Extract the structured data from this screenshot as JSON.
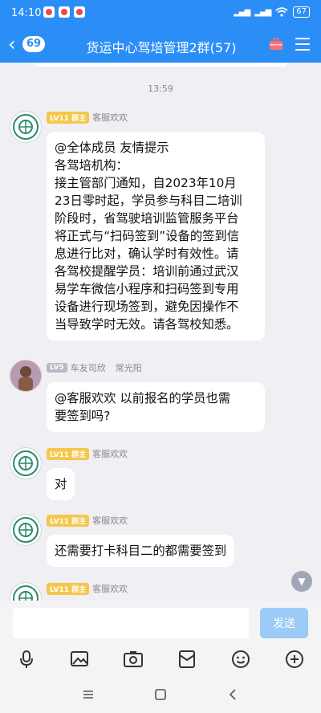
{
  "status_bar": {
    "time": "14:10",
    "battery": "67"
  },
  "header": {
    "unread_count": "69",
    "title": "货运中心驾培管理2群(57)"
  },
  "chat": {
    "timestamp": "13:59",
    "messages": [
      {
        "level": "LV11",
        "role": "群主",
        "sender": "客服欢欢",
        "lines": [
          "@全体成员 友情提示",
          "各驾培机构：",
          "接主管部门通知，自2023年10月",
          "23日零时起，学员参与科目二培训",
          "阶段时，省驾驶培训监管服务平台",
          "将正式与“扫码签到”设备的签到信",
          "息进行比对，确认学时有效性。请",
          "各驾校提醒学员：培训前通过武汉",
          "易学车微信小程序和扫码签到专用",
          "设备进行现场签到，避免因操作不",
          "当导致学时无效。请各驾校知悉。"
        ]
      },
      {
        "level": "LV5",
        "role": "车友司欣",
        "sender": "常光阳",
        "lines": [
          "@客服欢欢 以前报名的学员也需",
          "要签到吗?"
        ]
      },
      {
        "level": "LV11",
        "role": "群主",
        "sender": "客服欢欢",
        "lines": [
          "对"
        ]
      },
      {
        "level": "LV11",
        "role": "群主",
        "sender": "客服欢欢",
        "lines": [
          "还需要打卡科目二的都需要签到"
        ]
      },
      {
        "level": "LV11",
        "role": "群主",
        "sender": "客服欢欢",
        "lines": []
      }
    ]
  },
  "input": {
    "value": "",
    "placeholder": "",
    "send_label": "发送"
  },
  "colors": {
    "brand_blue": "#2b8ef7",
    "owner_badge": "#f5c74a",
    "member_badge": "#b7b9c7"
  },
  "icons": {
    "toolbar": [
      "microphone-icon",
      "image-icon",
      "camera-icon",
      "red-packet-icon",
      "emoji-icon",
      "plus-icon"
    ],
    "navbar": [
      "menu-nav-icon",
      "home-nav-icon",
      "back-nav-icon"
    ]
  }
}
